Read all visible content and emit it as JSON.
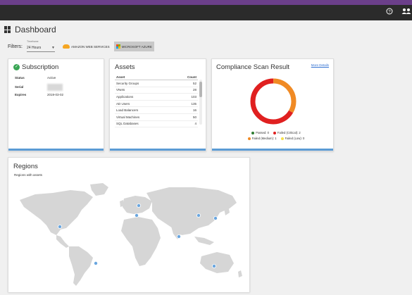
{
  "header": {
    "help_icon": "help-circle-icon",
    "user_icon": "users-icon"
  },
  "page": {
    "title": "Dashboard"
  },
  "filters": {
    "label": "Filters:",
    "timeframe_label": "Timeframe",
    "timeframe_value": "24 Hours",
    "providers": [
      {
        "label": "AMAZON WEB SERVICES",
        "icon": "aws-cloud-icon",
        "active": false
      },
      {
        "label": "MICROSOFT AZURE",
        "icon": "microsoft-azure-icon",
        "active": true
      }
    ]
  },
  "subscription": {
    "title": "Subscription",
    "status_label": "Status",
    "status_value": "Active",
    "serial_label": "Serial",
    "expires_label": "Expires",
    "expires_value": "2019-03-02"
  },
  "assets": {
    "title": "Assets",
    "col_asset": "Asset",
    "col_count": "Count",
    "rows": [
      {
        "name": "Security Groups",
        "count": "52"
      },
      {
        "name": "VNets",
        "count": "28"
      },
      {
        "name": "Applications",
        "count": "103"
      },
      {
        "name": "AD Users",
        "count": "135"
      },
      {
        "name": "Load Balancers",
        "count": "16"
      },
      {
        "name": "Virtual Machines",
        "count": "50"
      },
      {
        "name": "SQL Databases",
        "count": "4"
      }
    ]
  },
  "compliance": {
    "title": "Compliance Scan Result",
    "more_link": "More Details",
    "legend": [
      {
        "label": "Passed: 0",
        "color": "#2e7d32",
        "value": 0
      },
      {
        "label": "Failed (Critical): 2",
        "color": "#e02020",
        "value": 2
      },
      {
        "label": "Failed (Medium): 1",
        "color": "#f08a24",
        "value": 1
      },
      {
        "label": "Failed (Low): 0",
        "color": "#f5e04a",
        "value": 0
      }
    ]
  },
  "regions": {
    "title": "Regions",
    "subtitle": "Regions with assets"
  },
  "colors": {
    "accent": "#5b9bd5",
    "topbar": "#2b2b2b",
    "stripe": "#6b3f8a"
  }
}
